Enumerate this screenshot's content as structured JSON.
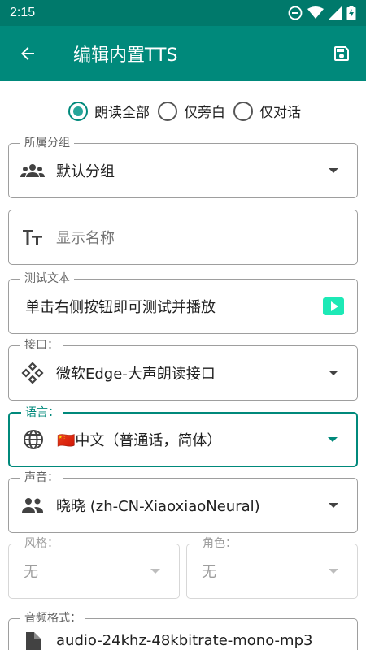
{
  "status_bar": {
    "time": "2:15"
  },
  "app_bar": {
    "title": "编辑内置TTS"
  },
  "radios": [
    {
      "label": "朗读全部",
      "selected": true
    },
    {
      "label": "仅旁白",
      "selected": false
    },
    {
      "label": "仅对话",
      "selected": false
    }
  ],
  "group": {
    "legend": "所属分组",
    "value": "默认分组"
  },
  "display_name": {
    "placeholder": "显示名称"
  },
  "test_text": {
    "legend": "测试文本",
    "value": "单击右侧按钮即可测试并播放"
  },
  "api": {
    "legend": "接口：",
    "value": "微软Edge-大声朗读接口"
  },
  "language": {
    "legend": "语言：",
    "value": "中文（普通话，简体）",
    "flag": "🇨🇳"
  },
  "voice": {
    "legend": "声音：",
    "value": "晓晓 (zh-CN-XiaoxiaoNeural)"
  },
  "style": {
    "legend": "风格：",
    "value": "无"
  },
  "role": {
    "legend": "角色：",
    "value": "无"
  },
  "audio_format": {
    "legend": "音频格式：",
    "value": "audio-24khz-48kbitrate-mono-mp3"
  },
  "colors": {
    "primary": "#00897b",
    "status": "#00796b",
    "accent": "#26a69a",
    "play": "#1de9b6"
  }
}
